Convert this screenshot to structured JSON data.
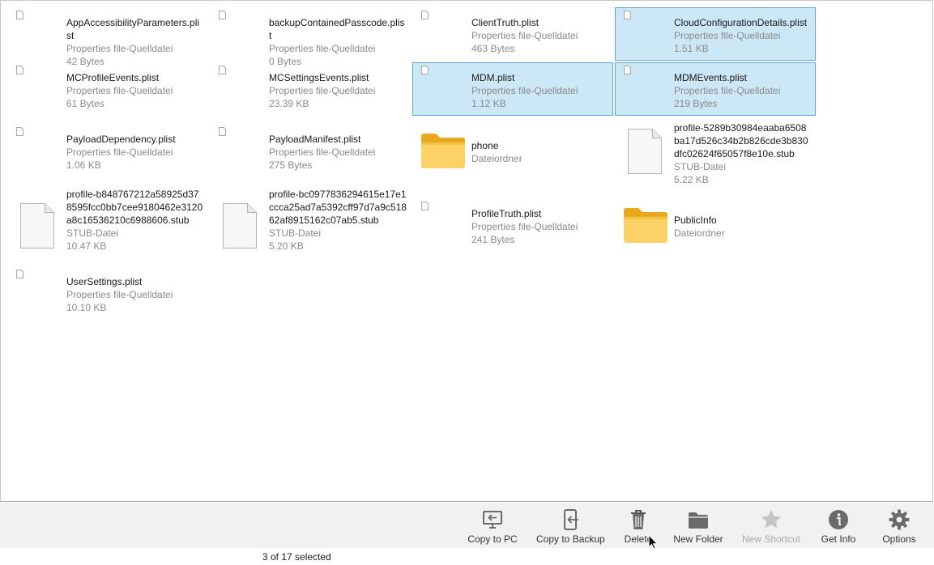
{
  "files": [
    {
      "name": "AppAccessibilityParameters.plist",
      "type": "Properties file-Quelldatei",
      "size": "42 Bytes",
      "icon": "file-icon",
      "selected": false
    },
    {
      "name": "backupContainedPasscode.plist",
      "type": "Properties file-Quelldatei",
      "size": "0 Bytes",
      "icon": "file-icon",
      "selected": false
    },
    {
      "name": "ClientTruth.plist",
      "type": "Properties file-Quelldatei",
      "size": "463 Bytes",
      "icon": "file-icon",
      "selected": false
    },
    {
      "name": "CloudConfigurationDetails.plist",
      "type": "Properties file-Quelldatei",
      "size": "1.51 KB",
      "icon": "file-icon",
      "selected": true
    },
    {
      "name": "MCProfileEvents.plist",
      "type": "Properties file-Quelldatei",
      "size": "61 Bytes",
      "icon": "file-icon",
      "selected": false
    },
    {
      "name": "MCSettingsEvents.plist",
      "type": "Properties file-Quelldatei",
      "size": "23.39 KB",
      "icon": "file-icon",
      "selected": false
    },
    {
      "name": "MDM.plist",
      "type": "Properties file-Quelldatei",
      "size": "1.12 KB",
      "icon": "file-icon",
      "selected": true
    },
    {
      "name": "MDMEvents.plist",
      "type": "Properties file-Quelldatei",
      "size": "219 Bytes",
      "icon": "file-icon",
      "selected": true
    },
    {
      "name": "PayloadDependency.plist",
      "type": "Properties file-Quelldatei",
      "size": "1.06 KB",
      "icon": "file-icon",
      "selected": false
    },
    {
      "name": "PayloadManifest.plist",
      "type": "Properties file-Quelldatei",
      "size": "275 Bytes",
      "icon": "file-icon",
      "selected": false
    },
    {
      "name": "phone",
      "type": "Dateiordner",
      "size": "",
      "icon": "folder-icon",
      "selected": false
    },
    {
      "name": "profile-5289b30984eaaba6508ba17d526c34b2b826cde3b830dfc02624f65057f8e10e.stub",
      "type": "STUB-Datei",
      "size": "5.22 KB",
      "icon": "stub-file-icon",
      "selected": false
    },
    {
      "name": "profile-b848767212a58925d378595fcc0bb7cee9180462e3120a8c16536210c6988606.stub",
      "type": "STUB-Datei",
      "size": "10.47 KB",
      "icon": "stub-file-icon",
      "selected": false
    },
    {
      "name": "profile-bc0977836294615e17e1ccca25ad7a5392cff97d7a9c51862af8915162c07ab5.stub",
      "type": "STUB-Datei",
      "size": "5.20 KB",
      "icon": "stub-file-icon",
      "selected": false
    },
    {
      "name": "ProfileTruth.plist",
      "type": "Properties file-Quelldatei",
      "size": "241 Bytes",
      "icon": "file-icon",
      "selected": false
    },
    {
      "name": "PublicInfo",
      "type": "Dateiordner",
      "size": "",
      "icon": "folder-icon",
      "selected": false
    },
    {
      "name": "UserSettings.plist",
      "type": "Properties file-Quelldatei",
      "size": "10.10 KB",
      "icon": "file-icon",
      "selected": false
    }
  ],
  "toolbar": {
    "copy_to_pc": "Copy to PC",
    "copy_to_backup": "Copy to Backup",
    "delete": "Delete",
    "new_folder": "New Folder",
    "new_shortcut": "New Shortcut",
    "get_info": "Get Info",
    "options": "Options"
  },
  "status": {
    "text": "3 of 17 selected"
  },
  "colors": {
    "selection_bg": "#cce8f6",
    "selection_border": "#5fa8d6",
    "folder": "#f6c94a",
    "icon_gray": "#707070"
  }
}
